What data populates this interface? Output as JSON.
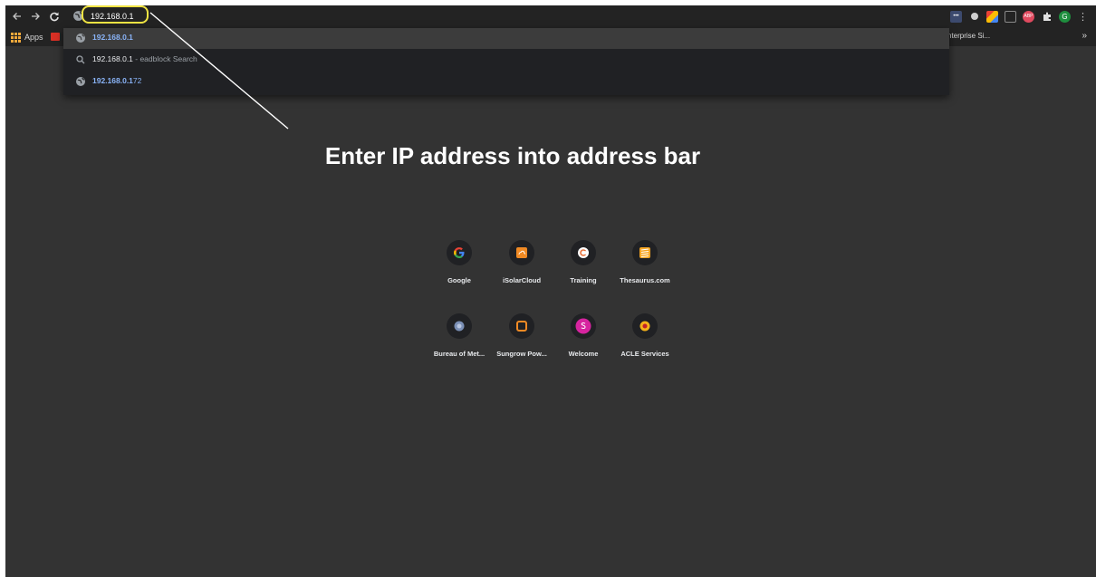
{
  "toolbar": {
    "back_icon": "arrow-left-icon",
    "forward_icon": "arrow-right-icon",
    "reload_icon": "reload-icon",
    "address_value": "192.168.0.1"
  },
  "bookmarks": {
    "apps_label": "Apps",
    "right_label": "nterprise Si...",
    "more_label": "»"
  },
  "suggestions": [
    {
      "bold": "192.168.0.1",
      "rest": "",
      "suffix": "",
      "icon": "globe-icon"
    },
    {
      "bold": "",
      "rest": "192.168.0.1",
      "suffix": " - eadblock Search",
      "icon": "search-icon"
    },
    {
      "bold": "192.168.0.1",
      "rest": "72",
      "suffix": "",
      "icon": "globe-icon"
    }
  ],
  "annotation": {
    "text": "Enter IP address into address bar",
    "highlight_color": "#f0e443"
  },
  "shortcuts": [
    {
      "label": "Google",
      "icon": "google-icon"
    },
    {
      "label": "iSolarCloud",
      "icon": "isolarcloud-icon"
    },
    {
      "label": "Training",
      "icon": "training-icon"
    },
    {
      "label": "Thesaurus.com",
      "icon": "thesaurus-icon"
    },
    {
      "label": "Bureau of Met...",
      "icon": "bureau-of-meteorology-icon"
    },
    {
      "label": "Sungrow Pow...",
      "icon": "sungrow-icon"
    },
    {
      "label": "Welcome",
      "icon": "welcome-icon"
    },
    {
      "label": "ACLE Services",
      "icon": "acle-services-icon"
    }
  ],
  "colors": {
    "background": "#333333",
    "toolbar": "#232323",
    "link_blue": "#8ab4f8"
  }
}
